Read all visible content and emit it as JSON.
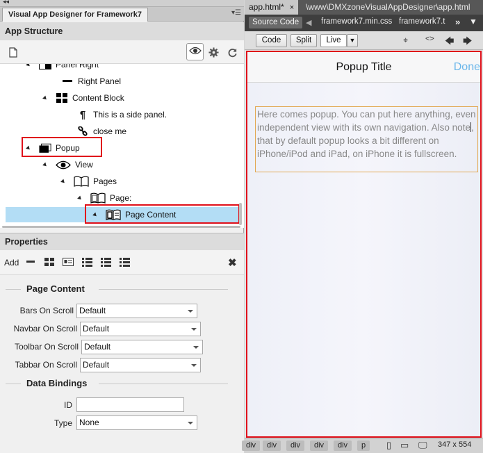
{
  "left_panel": {
    "tab_title": "Visual App Designer for Framework7",
    "app_structure": {
      "header": "App Structure",
      "tree": [
        {
          "label": "Panel Right",
          "icon": "panel-icon",
          "depth": 2
        },
        {
          "label": "Right Panel",
          "icon": "dash-icon",
          "depth": 3
        },
        {
          "label": "Content Block",
          "icon": "blocks-icon",
          "depth": 3
        },
        {
          "label": "This is a side panel.",
          "icon": "paragraph-icon",
          "depth": 4
        },
        {
          "label": "close me",
          "icon": "link-icon",
          "depth": 4
        },
        {
          "label": "Popup",
          "icon": "popup-icon",
          "depth": 1
        },
        {
          "label": "View",
          "icon": "eye-icon",
          "depth": 2
        },
        {
          "label": "Pages",
          "icon": "book-icon",
          "depth": 3
        },
        {
          "label": "Page:",
          "icon": "page-icon",
          "depth": 4
        },
        {
          "label": "Page Content",
          "icon": "page-content-icon",
          "depth": 5
        }
      ]
    },
    "properties": {
      "header": "Properties",
      "add_label": "Add",
      "sections": [
        {
          "title": "Page Content",
          "fields": [
            {
              "label": "Bars On Scroll",
              "value": "Default"
            },
            {
              "label": "Navbar On Scroll",
              "value": "Default"
            },
            {
              "label": "Toolbar On Scroll",
              "value": "Default"
            },
            {
              "label": "Tabbar On Scroll",
              "value": "Default"
            }
          ]
        },
        {
          "title": "Data Bindings",
          "fields": [
            {
              "label": "ID",
              "value": ""
            },
            {
              "label": "Type",
              "value": "None"
            }
          ]
        }
      ]
    }
  },
  "right_panel": {
    "doc_tab": "app.html*",
    "doc_path": "\\www\\DMXzoneVisualAppDesigner\\app.html",
    "related_files": {
      "source_code": "Source Code",
      "files": [
        "framework7.min.css",
        "framework7.t"
      ]
    },
    "view_buttons": {
      "code": "Code",
      "split": "Split",
      "live": "Live"
    },
    "popup": {
      "title": "Popup Title",
      "done": "Done",
      "text_before_caret": "Here comes popup. You can put here anything, even independent view with its own navigation. Also note",
      "text_after_caret": ", that by default popup looks a bit different on iPhone/iPod and iPad, on iPhone it is fullscreen."
    },
    "status_bar": {
      "tags": [
        "div",
        "div",
        "div",
        "div",
        "div",
        "p"
      ],
      "dimensions": "347 x 554"
    }
  },
  "colors": {
    "highlight_red": "#e0101a",
    "selection_blue": "#b3ddf5",
    "done_blue": "#6ab6ea",
    "text_box_border": "#e2a851"
  }
}
